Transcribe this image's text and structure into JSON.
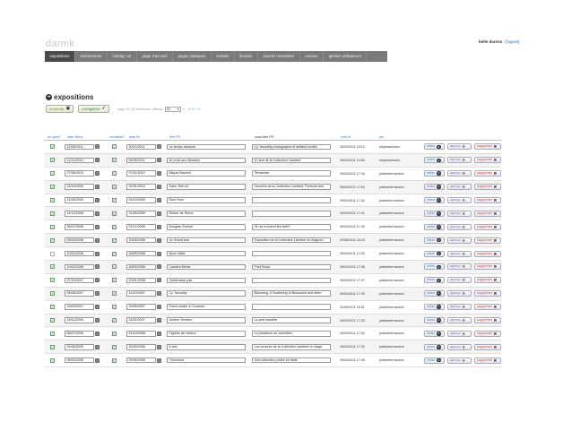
{
  "brand": "darmk",
  "user": {
    "name": "belle darnss",
    "logout": "[logout]"
  },
  "nav": [
    "expositions",
    "événements",
    "holiday' art",
    "page d'accueil",
    "pages statiques",
    "artistes",
    "librairie",
    "inscrits newsletter",
    "soutien",
    "gestion utilisateurs"
  ],
  "section": {
    "title": "expositions"
  },
  "toolbar": {
    "new_label": "nouveau",
    "save_label": "enregistrer",
    "pager_info": "page 1/2 (29 éléments)",
    "per_page_label": "afficher",
    "per_page": "20",
    "pages": "1 2"
  },
  "columns": [
    "en ligne?",
    "date début",
    "vendable?",
    "date fin",
    "titre FR",
    "sous-titre FR",
    "créé le",
    "par"
  ],
  "actions": {
    "edit": "éditer",
    "preview": "aperçu",
    "delete": "supprimer"
  },
  "rows": [
    {
      "online": true,
      "start": "12/08/2011",
      "vend": true,
      "end": "30/10/2011",
      "title": "Le temps retrouvé",
      "subtitle": "Cy Twombly photographe et artistes invités",
      "created": "26/04/2011 15:14",
      "by": "stephanebarrs"
    },
    {
      "online": true,
      "start": "12/11/2010",
      "vend": true,
      "end": "06/05/2011",
      "title": "Je crois aux Miracles",
      "subtitle": "10 ans de la Collection Lambert",
      "created": "26/04/2011 14:55",
      "by": "stephanebarrs"
    },
    {
      "online": true,
      "start": "27/06/2010",
      "vend": true,
      "end": "07/11/2010",
      "title": "Miquel Barceló",
      "subtitle": "Terramare",
      "created": "26/04/2011 17:44",
      "by": "justinebernardoni"
    },
    {
      "online": true,
      "start": "24/10/2009",
      "vend": true,
      "end": "31/01/2010",
      "title": "Sans-Titre #1",
      "subtitle": "Oeuvres de la Collection Lambert, Peinture des",
      "created": "26/04/2011 17:54",
      "by": "justinebernardoni"
    },
    {
      "online": true,
      "start": "21/06/2009",
      "vend": true,
      "end": "04/10/2009",
      "title": "Roni Horn",
      "subtitle": "",
      "created": "26/04/2011 17:42",
      "by": "justinebernardoni"
    },
    {
      "online": true,
      "start": "14/12/2008",
      "vend": true,
      "end": "31/05/2009",
      "title": "Retour de Rome",
      "subtitle": "",
      "created": "26/04/2011 17:41",
      "by": "justinebernardoni"
    },
    {
      "online": true,
      "start": "06/07/2008",
      "vend": true,
      "end": "02/11/2008",
      "title": "Douglas Gordon",
      "subtitle": "Où se trouvent les clefs?",
      "created": "26/04/2011 17:40",
      "by": "justinebernardoni"
    },
    {
      "online": true,
      "start": "05/05/2008",
      "vend": true,
      "end": "15/06/2008",
      "title": "Le Grand tour",
      "subtitle": "Exposition de la Collection Lambert en Avignon",
      "created": "03/06/2011 16:24",
      "by": "justinebernardoni"
    },
    {
      "online": false,
      "start": "10/02/2008",
      "vend": true,
      "end": "18/05/2008",
      "title": "Neon Bible",
      "subtitle": "",
      "created": "26/04/2011 17:53",
      "by": "justinebernardoni"
    },
    {
      "online": true,
      "start": "10/02/2008",
      "vend": true,
      "end": "18/05/2008",
      "title": "Candice Breitz",
      "subtitle": "Post Script",
      "created": "26/04/2011 17:38",
      "by": "justinebernardoni"
    },
    {
      "online": true,
      "start": "27/10/2007",
      "vend": true,
      "end": "20/01/2008",
      "title": "J'embrasse pas",
      "subtitle": "",
      "created": "26/04/2011 17:37",
      "by": "justinebernardoni"
    },
    {
      "online": true,
      "start": "05/08/2007",
      "vend": true,
      "end": "14/10/2007",
      "title": "Cy Twombly",
      "subtitle": "Blooming, A Scattering of Blossoms and other",
      "created": "26/04/2011 17:35",
      "by": "justinebernardoni"
    },
    {
      "online": true,
      "start": "16/03/2007",
      "vend": true,
      "end": "20/05/2007",
      "title": "Il faut rendre à Cézanne...",
      "subtitle": "",
      "created": "31/05/2011 16:51",
      "by": "justinebernardoni"
    },
    {
      "online": true,
      "start": "18/11/2006",
      "vend": true,
      "end": "11/02/2007",
      "title": "Andres Serrano",
      "subtitle": "La part maudite",
      "created": "26/04/2011 17:33",
      "by": "justinebernardoni"
    },
    {
      "online": true,
      "start": "06/07/2006",
      "vend": true,
      "end": "15/10/2006",
      "title": "Figures de l'acteur",
      "subtitle": "Le paradoxe du comédien",
      "created": "26/04/2011 17:31",
      "by": "justinebernardoni"
    },
    {
      "online": true,
      "start": "25/06/2005",
      "vend": true,
      "end": "30/05/2006",
      "title": "5 ans",
      "subtitle": "Les oeuvres de la Collection Lambert en Avign",
      "created": "26/04/2011 17:30",
      "by": "justinebernardoni"
    },
    {
      "online": true,
      "start": "05/02/2005",
      "vend": true,
      "end": "29/05/2005",
      "title": "Theorema",
      "subtitle": "Une collection privée en Italie",
      "created": "26/04/2011 17:28",
      "by": "justinebernardoni"
    }
  ]
}
